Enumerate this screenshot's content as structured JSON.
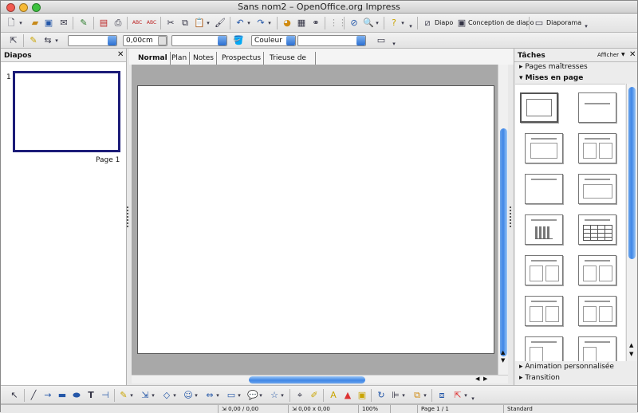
{
  "window": {
    "title": "Sans nom2 – OpenOffice.org Impress",
    "traffic_lights": [
      "#ff5f57",
      "#febc2e",
      "#28c840"
    ]
  },
  "toolbar_standard": {
    "diapo_label": "Diapo",
    "conception_label": "Conception de diapo",
    "diaporama_label": "Diaporama"
  },
  "toolbar_format": {
    "line_width_value": "0,00cm",
    "line_width_field_empty": "",
    "style_field_empty": "",
    "area_style_value": "Couleur",
    "area_color_value": ""
  },
  "slides_panel": {
    "title": "Diapos",
    "close_label": "✕",
    "slide_number": "1",
    "slide_label": "Page 1"
  },
  "view_tabs": [
    "Normal",
    "Plan",
    "Notes",
    "Prospectus",
    "Trieuse de diapositives"
  ],
  "tasks_panel": {
    "title": "Tâches",
    "afficher_label": "Afficher",
    "close_label": "✕",
    "sections": {
      "master_pages": "Pages maîtresses",
      "layouts": "Mises en page",
      "animation": "Animation personnalisée",
      "transition": "Transition"
    }
  },
  "status_bar": {
    "position": "0,00 / 0,00",
    "size": "0,00 x 0,00",
    "zoom": "100%",
    "page": "Page 1 / 1",
    "style": "Standard"
  }
}
